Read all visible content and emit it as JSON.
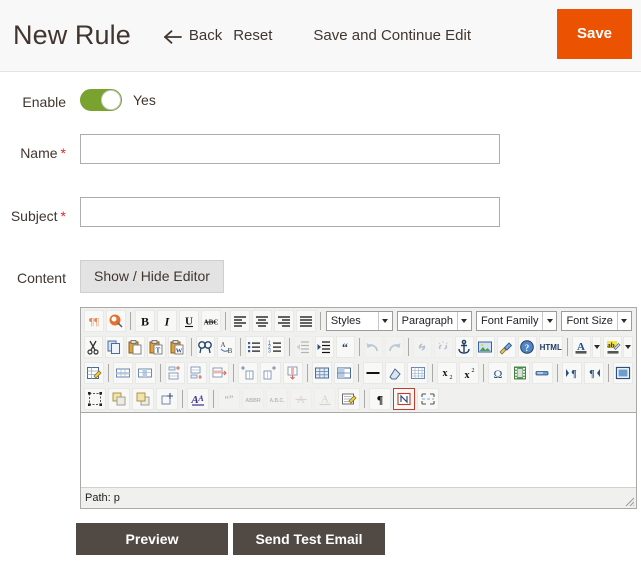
{
  "header": {
    "title": "New Rule",
    "back_label": "Back",
    "back_icon": "arrow-left-icon",
    "reset_label": "Reset",
    "save_continue_label": "Save and Continue Edit",
    "save_label": "Save",
    "save_color": "#eb5202"
  },
  "form": {
    "enable": {
      "label": "Enable",
      "toggle_state": "on",
      "toggle_text": "Yes",
      "toggle_color": "#79a22e"
    },
    "name": {
      "label": "Name",
      "required": "*",
      "value": "",
      "placeholder": ""
    },
    "subject": {
      "label": "Subject",
      "required": "*",
      "value": "",
      "placeholder": ""
    },
    "content": {
      "label": "Content",
      "toggle_editor_label": "Show / Hide Editor"
    },
    "required_star_color": "#e22626"
  },
  "editor": {
    "status_path": "Path: p",
    "body_text": "",
    "selects": [
      {
        "name": "styles",
        "label": "Styles"
      },
      {
        "name": "paragraph",
        "label": "Paragraph"
      },
      {
        "name": "fontfamily",
        "label": "Font Family"
      },
      {
        "name": "fontsize",
        "label": "Font Size"
      }
    ],
    "row1_icons": [
      "visual-chars-icon",
      "visual-blocks-icon",
      "bold-icon",
      "italic-icon",
      "underline-icon",
      "strikethrough-icon",
      "align-left-icon",
      "align-center-icon",
      "align-right-icon",
      "align-justify-icon"
    ],
    "row2_icons": [
      "cut-icon",
      "copy-icon",
      "paste-icon",
      "paste-text-icon",
      "paste-word-icon",
      "find-icon",
      "find-replace-icon",
      "bullet-list-icon",
      "numbered-list-icon",
      "outdent-icon",
      "indent-icon",
      "blockquote-icon",
      "undo-icon",
      "redo-icon",
      "link-icon",
      "unlink-icon",
      "anchor-icon",
      "image-icon",
      "cleanup-icon",
      "help-icon",
      "html-source-icon",
      "text-color-icon",
      "text-color-arrow",
      "background-color-icon",
      "background-color-arrow"
    ],
    "row3_icons": [
      "insert-edit-table-icon",
      "table-row-properties-icon",
      "table-cell-properties-icon",
      "insert-row-before-icon",
      "insert-row-after-icon",
      "delete-row-icon",
      "insert-column-before-icon",
      "insert-column-after-icon",
      "delete-column-icon",
      "split-cells-icon",
      "merge-cells-icon",
      "horizontal-rule-icon",
      "remove-format-icon",
      "toggle-guidelines-icon",
      "subscript-icon",
      "superscript-icon",
      "special-character-icon",
      "insert-media-icon",
      "page-break-icon",
      "ltr-icon",
      "rtl-icon",
      "fullscreen-icon"
    ],
    "row4_icons": [
      "select-all-icon",
      "insert-layer-icon",
      "move-forward-icon",
      "move-backward-icon",
      "style-props-icon",
      "citation-icon",
      "abbreviation-icon",
      "acronym-icon",
      "delete-text-icon",
      "insert-text-icon",
      "attributes-icon",
      "show-invisible-icon",
      "no-break-icon",
      "page-break-2-icon"
    ],
    "html_button_label": "HTML"
  },
  "actions": {
    "preview_label": "Preview",
    "send_test_email_label": "Send Test Email",
    "button_color": "#514943"
  }
}
